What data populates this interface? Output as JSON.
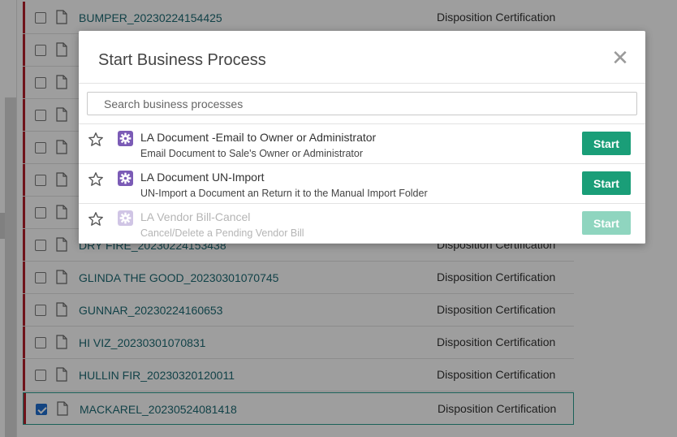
{
  "documents": [
    {
      "name": "BUMPER_20230224154425",
      "type": "Disposition Certification",
      "selected": false
    },
    {
      "name": "",
      "type": "",
      "selected": false
    },
    {
      "name": "",
      "type": "",
      "selected": false
    },
    {
      "name": "",
      "type": "",
      "selected": false
    },
    {
      "name": "",
      "type": "",
      "selected": false
    },
    {
      "name": "",
      "type": "",
      "selected": false
    },
    {
      "name": "",
      "type": "",
      "selected": false
    },
    {
      "name": "DRY FIRE_20230224153438",
      "type": "Disposition Certification",
      "selected": false
    },
    {
      "name": "GLINDA THE GOOD_20230301070745",
      "type": "Disposition Certification",
      "selected": false
    },
    {
      "name": "GUNNAR_20230224160653",
      "type": "Disposition Certification",
      "selected": false
    },
    {
      "name": "HI VIZ_20230301070831",
      "type": "Disposition Certification",
      "selected": false
    },
    {
      "name": "HULLIN FIR_20230320120011",
      "type": "Disposition Certification",
      "selected": false
    },
    {
      "name": "MACKAREL_20230524081418",
      "type": "Disposition Certification",
      "selected": true
    }
  ],
  "modal": {
    "title": "Start Business Process",
    "close_icon": "close-icon",
    "search": {
      "placeholder": "Search business processes",
      "value": ""
    },
    "processes": [
      {
        "title": "LA Document -Email to Owner or Administrator",
        "description": "Email Document to Sale's Owner or Administrator",
        "button": "Start",
        "enabled": true
      },
      {
        "title": "LA Document UN-Import",
        "description": "UN-Import a Document an Return it to the Manual Import Folder",
        "button": "Start",
        "enabled": true
      },
      {
        "title": "LA Vendor Bill-Cancel",
        "description": "Cancel/Delete a Pending Vendor Bill",
        "button": "Start",
        "enabled": false
      }
    ]
  },
  "colors": {
    "accent": "#1a9e78",
    "link": "#1d6b74",
    "stripe": "#b3202b",
    "process_icon": "#7b5bb6"
  }
}
